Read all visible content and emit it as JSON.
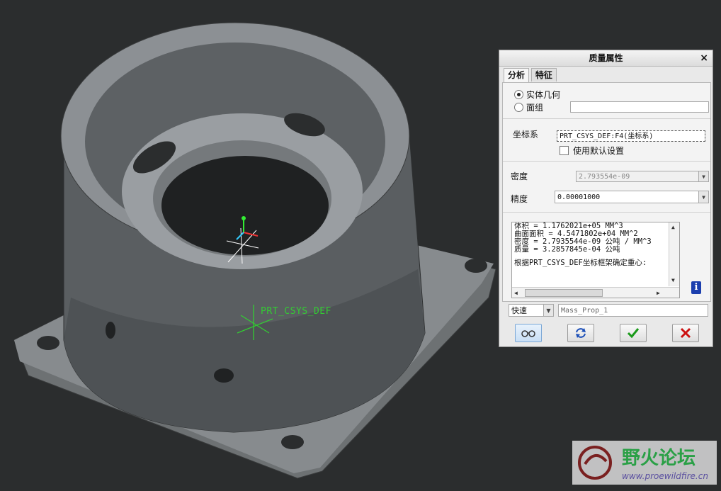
{
  "viewport": {
    "csys_label": "PRT_CSYS_DEF"
  },
  "dialog": {
    "title": "质量属性",
    "close_glyph": "×",
    "tabs": [
      {
        "label": "分析"
      },
      {
        "label": "特征"
      }
    ],
    "geometry_options": {
      "solid": "实体几何",
      "quilt": "面组",
      "quilt_value": ""
    },
    "csys": {
      "label": "坐标系",
      "value": "PRT_CSYS_DEF:F4(坐标系)",
      "use_default_label": "使用默认设置"
    },
    "density": {
      "label": "密度",
      "value": "2.793554e-09"
    },
    "accuracy": {
      "label": "精度",
      "value": "0.00001000"
    },
    "results": [
      "体积 =  1.1762021e+05  MM^3",
      "曲面面积 =  4.5471802e+04  MM^2",
      "密度 =  2.7935544e-09 公吨 / MM^3",
      "质量 =  3.2857845e-04 公吨",
      "",
      "根据PRT_CSYS_DEF坐标框架确定重心:"
    ],
    "mode": {
      "value": "快速"
    },
    "feature_name": {
      "value": "Mass_Prop_1"
    },
    "buttons": {
      "preview_icon": "glasses-icon",
      "repeat_icon": "repeat-icon",
      "ok_icon": "checkmark-icon",
      "cancel_icon": "x-icon"
    },
    "colors": {
      "ok": "#1a9a1a",
      "cancel": "#cc1111",
      "info": "#1c3fae"
    }
  },
  "watermark": {
    "text": "野火论坛",
    "url": "www.proewildfire.cn"
  }
}
